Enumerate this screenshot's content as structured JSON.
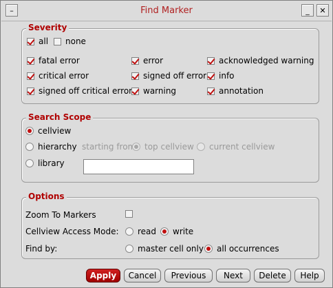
{
  "window": {
    "title": "Find Marker"
  },
  "colors": {
    "accent": "#b00000",
    "check": "#c01010"
  },
  "severity": {
    "legend": "Severity",
    "all_label": "all",
    "none_label": "none",
    "items": [
      {
        "label": "fatal error",
        "checked": true
      },
      {
        "label": "error",
        "checked": true
      },
      {
        "label": "acknowledged warning",
        "checked": true
      },
      {
        "label": "critical error",
        "checked": true
      },
      {
        "label": "signed off error",
        "checked": true
      },
      {
        "label": "info",
        "checked": true
      },
      {
        "label": "signed off critical error",
        "checked": true
      },
      {
        "label": "warning",
        "checked": true
      },
      {
        "label": "annotation",
        "checked": true
      }
    ]
  },
  "scope": {
    "legend": "Search Scope",
    "cellview_label": "cellview",
    "hierarchy_label": "hierarchy",
    "starting_from_label": "starting from:",
    "top_cellview_label": "top cellview",
    "current_cellview_label": "current cellview",
    "library_label": "library",
    "library_value": "",
    "selected": "cellview"
  },
  "options": {
    "legend": "Options",
    "zoom_label": "Zoom To Markers",
    "access_label": "Cellview Access Mode:",
    "read_label": "read",
    "write_label": "write",
    "findby_label": "Find by:",
    "master_label": "master cell only",
    "all_occ_label": "all occurrences"
  },
  "buttons": {
    "apply": "Apply",
    "cancel": "Cancel",
    "previous": "Previous",
    "next": "Next",
    "delete": "Delete",
    "help": "Help"
  }
}
